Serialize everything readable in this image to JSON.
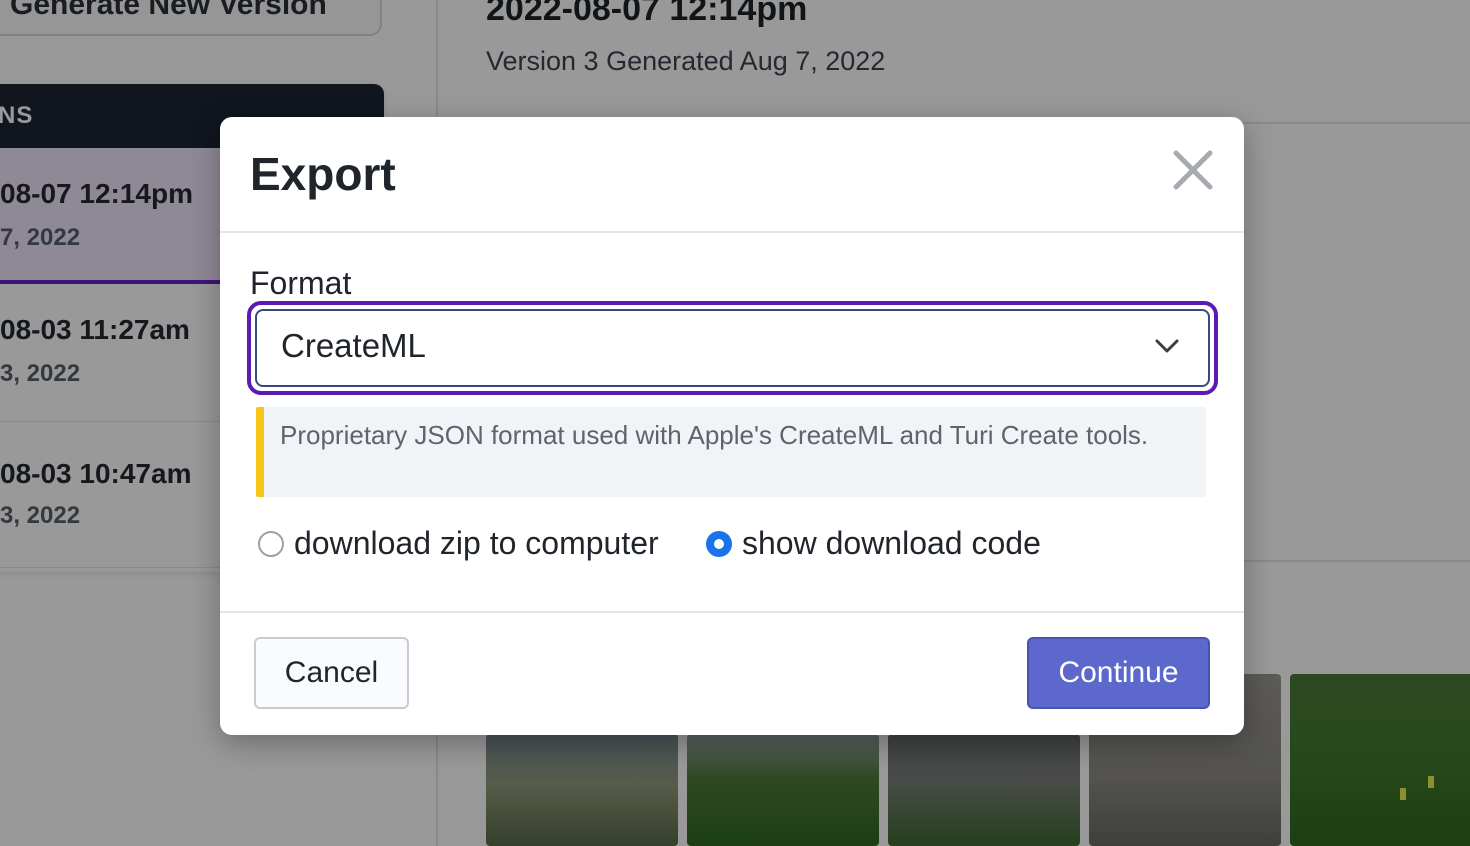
{
  "sidebar": {
    "generate_button": "Generate New Version",
    "versions_header": "NS",
    "versions": [
      {
        "title": "08-07 12:14pm",
        "date": "7, 2022"
      },
      {
        "title": "08-03 11:27am",
        "date": "3, 2022"
      },
      {
        "title": "08-03 10:47am",
        "date": "3, 2022"
      }
    ]
  },
  "main": {
    "title": "2022-08-07 12:14pm",
    "subtitle": "Version 3 Generated Aug 7, 2022"
  },
  "modal": {
    "title": "Export",
    "format_label": "Format",
    "selected_format": "CreateML",
    "format_description": "Proprietary JSON format used with Apple's CreateML and Turi Create tools.",
    "options": [
      {
        "label": "download zip to computer",
        "checked": false
      },
      {
        "label": "show download code",
        "checked": true
      }
    ],
    "cancel_label": "Cancel",
    "continue_label": "Continue"
  },
  "colors": {
    "accent_focus": "#5b1bb3",
    "primary_button": "#5c68cc",
    "info_bar": "#f5c518",
    "radio_checked": "#1a73e8"
  }
}
